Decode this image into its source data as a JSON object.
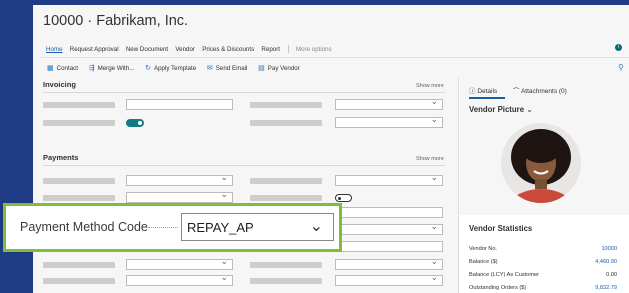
{
  "page": {
    "title": "10000 · Fabrikam, Inc."
  },
  "nav": {
    "items": [
      "Home",
      "Request Approval",
      "New Document",
      "Vendor",
      "Prices & Discounts",
      "Report"
    ],
    "more": "More options"
  },
  "actions": {
    "items": [
      "Contact",
      "Merge With...",
      "Apply Template",
      "Send Email",
      "Pay Vendor"
    ]
  },
  "sections": {
    "invoicing": {
      "title": "Invoicing",
      "show_more": "Show more"
    },
    "payments": {
      "title": "Payments",
      "show_more": "Show more"
    }
  },
  "toggles": {
    "invoicing_toggle_on": true,
    "payments_toggle_on": false
  },
  "factbox": {
    "tabs": [
      "Details",
      "Attachments (0)"
    ],
    "vendor_picture_title": "Vendor Picture",
    "stats_title": "Vendor Statistics",
    "stats": [
      {
        "label": "Vendor No.",
        "value": "10000",
        "link": true
      },
      {
        "label": "Balance ($)",
        "value": "4,460.90",
        "link": true
      },
      {
        "label": "Balance (LCY) As Customer",
        "value": "0.00",
        "link": false
      },
      {
        "label": "Outstanding Orders ($)",
        "value": "9,832.79",
        "link": true
      }
    ]
  },
  "callout": {
    "label": "Payment Method Code",
    "value": "REPAY_AP"
  },
  "colors": {
    "background": "#1f3b86",
    "accent": "#127b86",
    "link": "#1b5ea8",
    "highlight_border": "#7dbe3d"
  },
  "icons": {
    "contact": "contact-icon",
    "merge": "merge-icon",
    "template": "template-icon",
    "email": "email-icon",
    "pay": "pay-vendor-icon",
    "info": "info-icon",
    "pin": "personalize-icon",
    "details": "info-circle-icon",
    "attachments": "paperclip-icon",
    "dropdown": "chevron-down-icon"
  }
}
